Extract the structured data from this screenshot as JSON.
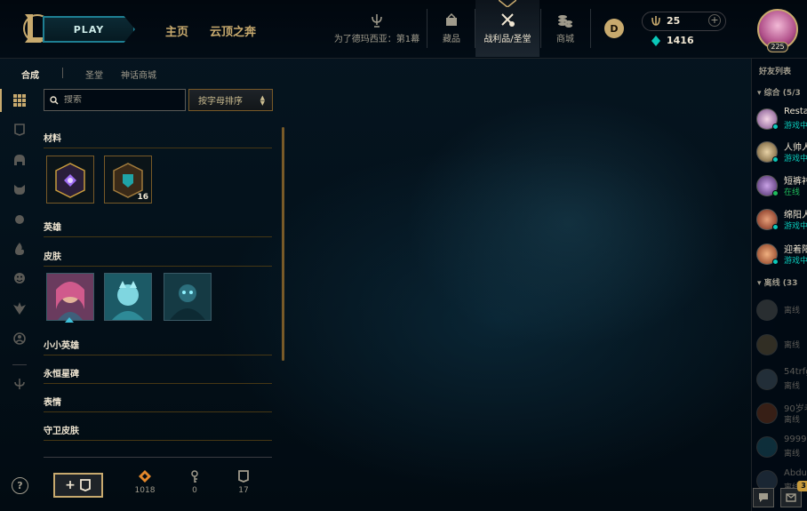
{
  "header": {
    "play_label": "PLAY",
    "nav": [
      "主页",
      "云顶之奔"
    ],
    "items": [
      {
        "label": "为了德玛西亚：第1幕",
        "icon": "trophy-icon"
      },
      {
        "label": "藏品",
        "icon": "collection-icon"
      },
      {
        "label": "战利品/圣堂",
        "icon": "loot-icon",
        "active": true
      },
      {
        "label": "商城",
        "icon": "store-icon"
      }
    ],
    "rp_icon_label": "D",
    "currency": {
      "essence": "25",
      "blue_essence": "1416"
    },
    "profile": {
      "level": "225"
    }
  },
  "subtabs": [
    "合成",
    "圣堂",
    "神话商城"
  ],
  "search": {
    "placeholder": "搜索",
    "value": ""
  },
  "sort": {
    "label": "按字母排序"
  },
  "categories": [
    "材料",
    "英雄",
    "皮肤",
    "小小英雄",
    "永恒星碑",
    "表情",
    "守卫皮肤"
  ],
  "materials": [
    {
      "name": "hextech-chest",
      "count": ""
    },
    {
      "name": "masterwork-chest",
      "count": "16"
    }
  ],
  "skins": [
    "skin-1",
    "skin-2",
    "skin-3"
  ],
  "bottom": {
    "help_label": "?",
    "add_label": "+",
    "stats": [
      {
        "icon": "orange-essence-icon",
        "value": "1018"
      },
      {
        "icon": "key-icon",
        "value": "0"
      },
      {
        "icon": "chest-icon",
        "value": "17"
      }
    ]
  },
  "friends": {
    "title": "好友列表",
    "groups": [
      {
        "label": "综合 (5/3"
      },
      {
        "label": "离线 (33"
      }
    ],
    "online": [
      {
        "name": "Resta",
        "status": "游戏中",
        "status_color": "#0ac8b9"
      },
      {
        "name": "人帅人",
        "status": "游戏中",
        "status_color": "#0ac8b9"
      },
      {
        "name": "短裤衬",
        "status": "在线",
        "status_color": "#1fbc5b"
      },
      {
        "name": "绵阳人",
        "status": "游戏中",
        "status_color": "#0ac8b9"
      },
      {
        "name": "迎着阳",
        "status": "游戏中",
        "status_color": "#0ac8b9"
      }
    ],
    "offline": [
      {
        "name": "",
        "status": "离线"
      },
      {
        "name": "",
        "status": "离线"
      },
      {
        "name": "54trfg",
        "status": "离线"
      },
      {
        "name": "90岁老",
        "status": "离线"
      },
      {
        "name": "99999",
        "status": "离线"
      },
      {
        "name": "Abdu",
        "status": "离线"
      }
    ],
    "notif_count": "3"
  },
  "colors": {
    "gold": "#c8aa6e",
    "teal": "#0ac8b9",
    "online_green": "#1fbc5b"
  }
}
